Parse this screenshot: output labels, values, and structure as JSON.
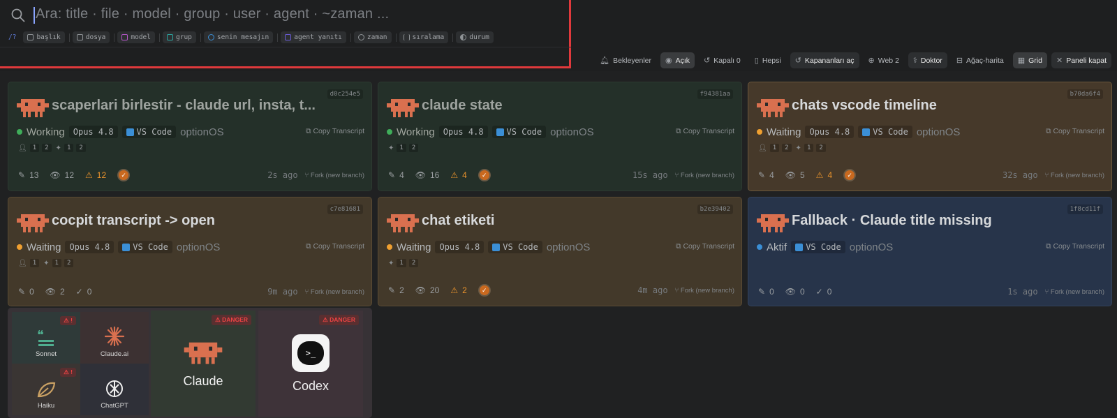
{
  "search": {
    "placeholder": "Ara: title · file · model · group · user · agent · ~zaman ...",
    "help": "/?",
    "filters": [
      {
        "label": "başlık",
        "icon": "heading-icon",
        "color": "#8f9396"
      },
      {
        "label": "dosya",
        "icon": "file-icon",
        "color": "#8f9396"
      },
      {
        "label": "model",
        "icon": "model-icon",
        "color": "#b455c7"
      },
      {
        "label": "grup",
        "icon": "group-icon",
        "color": "#2ca6a0"
      },
      {
        "label": "senin mesajın",
        "icon": "user-icon",
        "color": "#3b8fd6"
      },
      {
        "label": "agent yanıtı",
        "icon": "agent-icon",
        "color": "#6a5cd8"
      },
      {
        "label": "zaman",
        "icon": "clock-icon",
        "color": "#8f9396"
      },
      {
        "label": "sıralama",
        "icon": "sort-icon",
        "color": "#8f9396"
      },
      {
        "label": "durum",
        "icon": "contrast-icon",
        "color": "#8f9396"
      }
    ]
  },
  "toolbar": {
    "items": [
      {
        "label": "Bekleyenler",
        "icon": "bell-icon"
      },
      {
        "label": "Açık",
        "icon": "radio-icon",
        "active": true
      },
      {
        "label": "Kapalı 0",
        "icon": "history-icon"
      },
      {
        "label": "Hepsi",
        "icon": "clipboard-icon"
      },
      {
        "label": "Kapananları aç",
        "icon": "restore-icon"
      },
      {
        "label": "Web 2",
        "icon": "web-icon"
      },
      {
        "label": "Doktor",
        "icon": "stethoscope-icon"
      },
      {
        "label": "Ağaç-harita",
        "icon": "tree-icon"
      },
      {
        "label": "Grid",
        "icon": "grid-icon",
        "active": true
      },
      {
        "label": "Paneli kapat",
        "icon": "close-icon"
      }
    ]
  },
  "cards": [
    {
      "hash": "d0c254e5",
      "title": "scaperlari birlestir - claude url, insta, t...",
      "status": "Working",
      "model": "Opus 4.8",
      "ide": "VS Code",
      "org": "optionOS",
      "copy": "Copy Transcript",
      "users": [
        "1",
        "2"
      ],
      "agents": [
        "1",
        "2"
      ],
      "edits": "13",
      "views": "12",
      "warns": "12",
      "ago": "2s ago",
      "fork": "Fork (new branch)"
    },
    {
      "hash": "f94381aa",
      "title": "claude state",
      "status": "Working",
      "model": "Opus 4.8",
      "ide": "VS Code",
      "org": "optionOS",
      "copy": "Copy Transcript",
      "users": [],
      "agents": [
        "1",
        "2"
      ],
      "edits": "4",
      "views": "16",
      "warns": "4",
      "ago": "15s ago",
      "fork": "Fork (new branch)"
    },
    {
      "hash": "b70da6f4",
      "title": "chats vscode timeline",
      "status": "Waiting",
      "model": "Opus 4.8",
      "ide": "VS Code",
      "org": "optionOS",
      "copy": "Copy Transcript",
      "users": [
        "1",
        "2"
      ],
      "agents": [
        "1",
        "2"
      ],
      "edits": "4",
      "views": "5",
      "warns": "4",
      "ago": "32s ago",
      "fork": "Fork (new branch)"
    },
    {
      "hash": "c7e81681",
      "title": "cocpit transcript -> open",
      "status": "Waiting",
      "model": "Opus 4.8",
      "ide": "VS Code",
      "org": "optionOS",
      "copy": "Copy Transcript",
      "users": [
        "1"
      ],
      "agents": [
        "1",
        "2"
      ],
      "edits": "0",
      "views": "2",
      "checks": "0",
      "ago": "9m ago",
      "fork": "Fork (new branch)"
    },
    {
      "hash": "b2e39402",
      "title": "chat etiketi",
      "status": "Waiting",
      "model": "Opus 4.8",
      "ide": "VS Code",
      "org": "optionOS",
      "copy": "Copy Transcript",
      "users": [],
      "agents": [
        "1",
        "2"
      ],
      "edits": "2",
      "views": "20",
      "warns": "2",
      "ago": "4m ago",
      "fork": "Fork (new branch)"
    },
    {
      "hash": "1f8cd11f",
      "title": "Fallback · Claude title missing",
      "status": "Aktif",
      "model": "",
      "ide": "VS Code",
      "org": "optionOS",
      "copy": "Copy Transcript",
      "users": [],
      "agents": [],
      "edits": "0",
      "views": "0",
      "checks": "0",
      "ago": "1s ago",
      "fork": "Fork (new branch)"
    }
  ],
  "picker": {
    "sonnet": "Sonnet",
    "claude_ai": "Claude.ai",
    "haiku": "Haiku",
    "chatgpt": "ChatGPT",
    "claude": "Claude",
    "codex": "Codex",
    "danger": "DANGER",
    "excl": "!"
  },
  "colors": {
    "working": "#3fae5a",
    "waiting": "#f0a030",
    "active": "#3b8fd6",
    "danger": "#e44444",
    "mascot": "#d9704f"
  }
}
